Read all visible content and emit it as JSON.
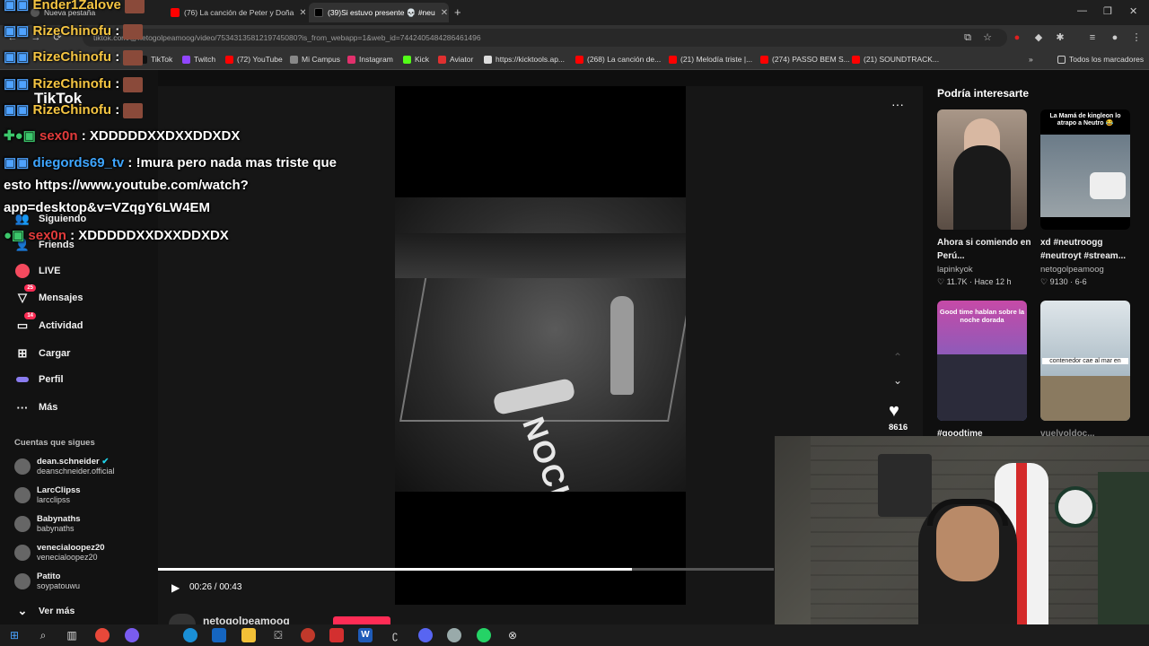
{
  "tabs": [
    {
      "label": "Nueva pestaña"
    },
    {
      "label": "(76) La canción de Peter y Doña"
    },
    {
      "label": "(39)Si estuvo presente 💀 #neu"
    }
  ],
  "address": {
    "url": "tiktok.com/@netogolpeamoog/video/7534313581219745080?is_from_webapp=1&web_id=7442405484286461496"
  },
  "bookmarks": [
    {
      "label": "TikTok",
      "color": "#111111"
    },
    {
      "label": "Twitch",
      "color": "#9146ff"
    },
    {
      "label": "(72) YouTube",
      "color": "#ff0000"
    },
    {
      "label": "Mi Campus",
      "color": "#888888"
    },
    {
      "label": "Instagram",
      "color": "#e1306c"
    },
    {
      "label": "Kick",
      "color": "#53fc18"
    },
    {
      "label": "Aviator",
      "color": "#e03030"
    },
    {
      "label": "https://kicktools.ap...",
      "color": "#dddddd"
    },
    {
      "label": "(268) La canción de...",
      "color": "#ff0000"
    },
    {
      "label": "(21) Melodía triste |...",
      "color": "#ff0000"
    },
    {
      "label": "(274) PASSO BEM S...",
      "color": "#ff0000"
    },
    {
      "label": "(21) SOUNDTRACK...",
      "color": "#ff0000"
    }
  ],
  "bookmarks_all": "Todos los marcadores",
  "sidebar": {
    "logo": "TikTok",
    "nav": [
      {
        "label": "Siguiendo",
        "icon": "people-icon"
      },
      {
        "label": "Friends",
        "icon": "friends-icon"
      },
      {
        "label": "LIVE",
        "icon": "live-icon"
      },
      {
        "label": "Mensajes",
        "icon": "message-icon",
        "badge": "25"
      },
      {
        "label": "Actividad",
        "icon": "activity-icon",
        "badge": "14"
      },
      {
        "label": "Cargar",
        "icon": "upload-icon"
      },
      {
        "label": "Perfil",
        "icon": "profile-icon"
      },
      {
        "label": "Más",
        "icon": "more-icon"
      }
    ],
    "following_title": "Cuentas que sigues",
    "following": [
      {
        "name": "dean.schneider",
        "handle": "deanschneider.official"
      },
      {
        "name": "LarcClipss",
        "handle": "larcclipss"
      },
      {
        "name": "Babynaths",
        "handle": "babynaths"
      },
      {
        "name": "venecialoopez20",
        "handle": "venecialoopez20"
      },
      {
        "name": "Patito",
        "handle": "soypatouwu"
      }
    ],
    "see_more": "Ver más"
  },
  "chat": [
    {
      "user": "Ender1Zalove",
      "text": ""
    },
    {
      "user": "RizeChinofu",
      "text": ":"
    },
    {
      "user": "RizeChinofu",
      "text": ":"
    },
    {
      "user": "RizeChinofu",
      "text": ":"
    },
    {
      "user": "RizeChinofu",
      "text": ":"
    },
    {
      "user": "sex0n",
      "text": ": XDDDDDXXDXXDDXDX"
    },
    {
      "user": "diegords69_tv",
      "text": ": !mura pero nada mas triste que"
    },
    {
      "user": "",
      "text": "esto https://www.youtube.com/watch?"
    },
    {
      "user": "",
      "text": "app=desktop&v=VZqgY6LW4EM"
    },
    {
      "user": "sex0n",
      "text": ": XDDDDDXXDXXDDXDX"
    }
  ],
  "video": {
    "time": "00:26 / 00:43",
    "progress": 0.77,
    "likes": "8616",
    "author": "netogolpeamoog",
    "ring_text": "NOCHE"
  },
  "recommend": {
    "title": "Podría interesarte",
    "items": [
      {
        "title": "Ahora si comiendo en Perú...",
        "author": "lapinkyok",
        "likes": "11.7K",
        "time": "Hace 12 h",
        "overlay": ""
      },
      {
        "title": "xd #neutroogg #neutroyt #stream...",
        "author": "netogolpeamoog",
        "likes": "9130",
        "time": "6-6",
        "overlay": "La Mamá de kingleon lo atrapo a Neutro 😂"
      },
      {
        "title": "#goodtime",
        "author": "",
        "likes": "",
        "time": "",
        "overlay": "Good time hablan sobre la noche dorada"
      },
      {
        "title": "vuelvoldoc...",
        "author": "",
        "likes": "",
        "time": "",
        "overlay": "contenedor cae al mar en"
      }
    ]
  }
}
